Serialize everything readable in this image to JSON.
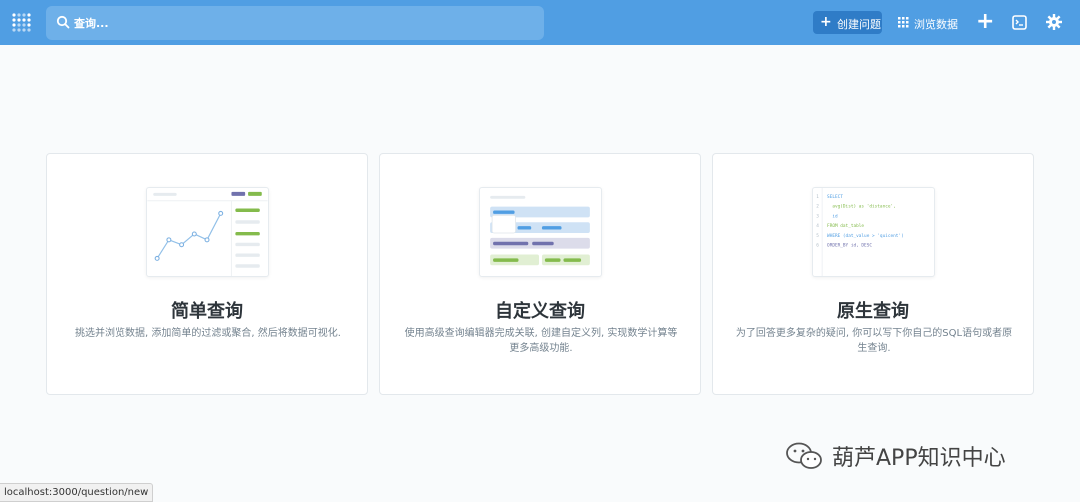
{
  "topbar": {
    "search_placeholder": "查询...",
    "new_question_label": "创建问题",
    "browse_data_label": "浏览数据",
    "accent_color": "#509ee3"
  },
  "cards": [
    {
      "title": "简单查询",
      "description": "挑选并浏览数据, 添加简单的过滤或聚合, 然后将数据可视化.",
      "icon": "line-chart-illustration"
    },
    {
      "title": "自定义查询",
      "description": "使用高级查询编辑器完成关联, 创建自定义列, 实现数学计算等更多高级功能.",
      "icon": "query-builder-illustration"
    },
    {
      "title": "原生查询",
      "description": "为了回答更多复杂的疑问, 你可以写下你自己的SQL语句或者原生查询.",
      "icon": "sql-editor-illustration"
    }
  ],
  "sql_sample": {
    "line_numbers": [
      "1",
      "2",
      "3",
      "4",
      "5",
      "6"
    ],
    "lines": [
      "SELECT",
      "  avg(Dist) as 'distance',",
      "  id",
      "FROM dat_table",
      "WHERE (dat_value > 'quicent')",
      "ORDER_BY id, DESC"
    ]
  },
  "status_url": "localhost:3000/question/new",
  "watermark_text": "葫芦APP知识中心"
}
